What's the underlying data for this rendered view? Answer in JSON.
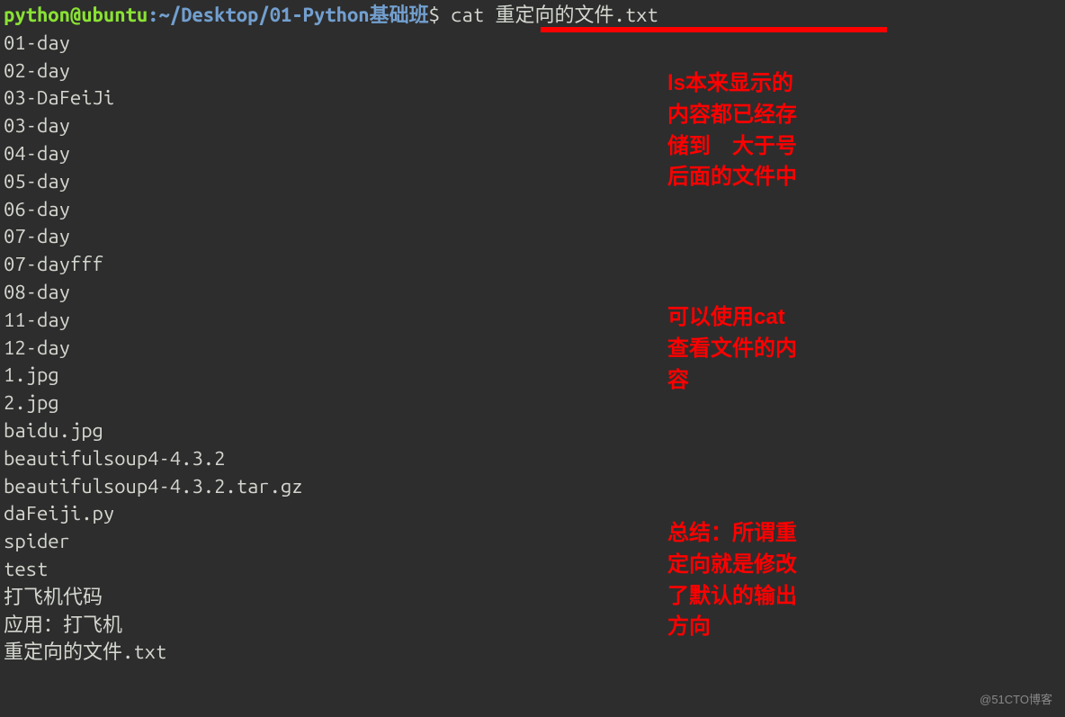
{
  "prompt": {
    "user": "python@ubuntu",
    "colon": ":",
    "path": "~/Desktop/01-Python基础班",
    "dollar": "$",
    "command": " cat 重定向的文件.txt"
  },
  "output": [
    "01-day",
    "02-day",
    "03-DaFeiJi",
    "03-day",
    "04-day",
    "05-day",
    "06-day",
    "07-day",
    "07-dayfff",
    "08-day",
    "11-day",
    "12-day",
    "1.jpg",
    "2.jpg",
    "baidu.jpg",
    "beautifulsoup4-4.3.2",
    "beautifulsoup4-4.3.2.tar.gz",
    "daFeiji.py",
    "spider",
    "test",
    "打飞机代码",
    "应用：打飞机",
    "重定向的文件.txt"
  ],
  "annotations": {
    "note1_line1": "ls本来显示的",
    "note1_line2": "内容都已经存",
    "note1_line3": "储到　大于号",
    "note1_line4": "后面的文件中",
    "note2_line1": "可以使用cat",
    "note2_line2": "查看文件的内",
    "note2_line3": "容",
    "note3_line1": "总结：所谓重",
    "note3_line2": "定向就是修改",
    "note3_line3": "了默认的输出",
    "note3_line4": "方向"
  },
  "watermark": "@51CTO博客"
}
